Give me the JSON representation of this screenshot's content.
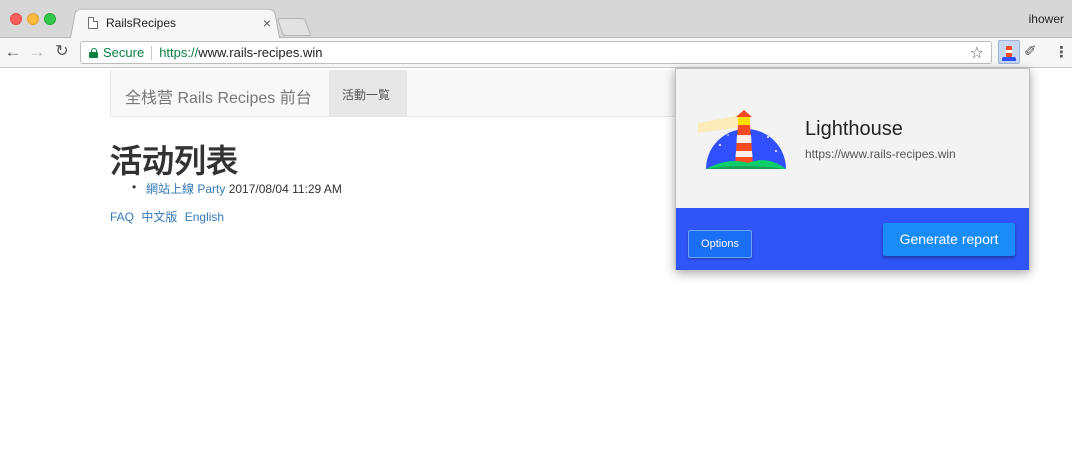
{
  "browser": {
    "tab": {
      "title": "RailsRecipes",
      "close": "×"
    },
    "profile": "ihower",
    "omnibox": {
      "secure_label": "Secure",
      "url_scheme": "https://",
      "url_rest": "www.rails-recipes.win"
    },
    "icons": {
      "back": "back-arrow-icon",
      "forward": "forward-arrow-icon",
      "reload": "reload-icon",
      "star": "star-icon",
      "lighthouse": "lighthouse-extension-icon",
      "brush": "brush-extension-icon",
      "menu": "menu-dots-icon"
    }
  },
  "page": {
    "navbar": {
      "brand": "全栈营 Rails Recipes 前台",
      "active_link": "活動一覧"
    },
    "title": "活动列表",
    "events": [
      {
        "name": "網站上線 Party",
        "datetime": "2017/08/04 11:29 AM"
      }
    ],
    "footer": {
      "faq": "FAQ",
      "zh": "中文版",
      "en": "English"
    }
  },
  "popup": {
    "title": "Lighthouse",
    "url": "https://www.rails-recipes.win",
    "options_label": "Options",
    "generate_label": "Generate report"
  },
  "colors": {
    "secure_green": "#0b8043",
    "link_blue": "#337ab7",
    "popup_footer_blue": "#2f55f7",
    "generate_button_blue": "#1a8cf8"
  }
}
